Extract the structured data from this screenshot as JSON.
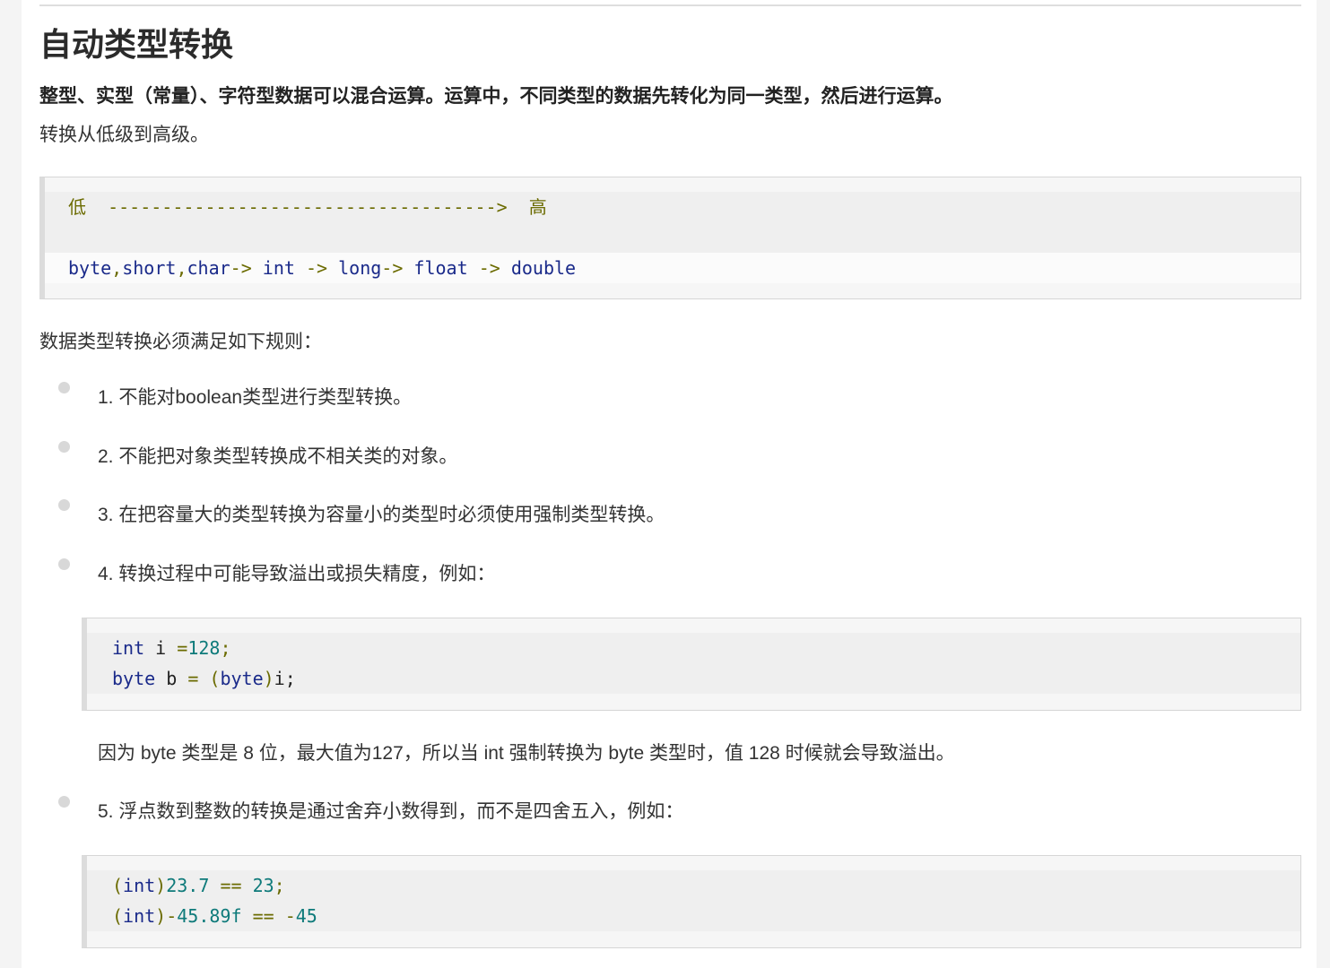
{
  "title": "自动类型转换",
  "lead": "整型、实型（常量）、字符型数据可以混合运算。运算中，不同类型的数据先转化为同一类型，然后进行运算。",
  "direction_text": "转换从低级到高级。",
  "order_block": {
    "low": "低",
    "arrow": "------------------------------------>",
    "high": "高",
    "types": [
      "byte",
      "short",
      "char",
      "int",
      "long",
      "float",
      "double"
    ],
    "separator": ",",
    "arrow_short": "->"
  },
  "rules_intro": "数据类型转换必须满足如下规则：",
  "rules": [
    "1. 不能对boolean类型进行类型转换。",
    "2. 不能把对象类型转换成不相关类的对象。",
    "3. 在把容量大的类型转换为容量小的类型时必须使用强制类型转换。",
    "4. 转换过程中可能导致溢出或损失精度，例如：",
    "5. 浮点数到整数的转换是通过舍弃小数得到，而不是四舍五入，例如："
  ],
  "example_overflow": {
    "line1": {
      "kw": "int",
      "var": "i",
      "op": "=",
      "num": "128",
      "end": ";"
    },
    "line2": {
      "kw": "byte",
      "var": "b",
      "op": "=",
      "lparen": "(",
      "cast": "byte",
      "rparen": ")",
      "tail": "i;"
    }
  },
  "overflow_note": "因为 byte 类型是 8 位，最大值为127，所以当 int 强制转换为 byte 类型时，值 128 时候就会导致溢出。",
  "example_float": {
    "line1": {
      "lparen": "(",
      "kw": "int",
      "rparen": ")",
      "num1": "23.7",
      "op": "==",
      "num2": "23",
      "end": ";"
    },
    "line2": {
      "lparen": "(",
      "kw": "int",
      "rparen": ")",
      "minus1": "-",
      "num1": "45.89f",
      "op": "==",
      "minus2": "-",
      "num2": "45"
    }
  }
}
